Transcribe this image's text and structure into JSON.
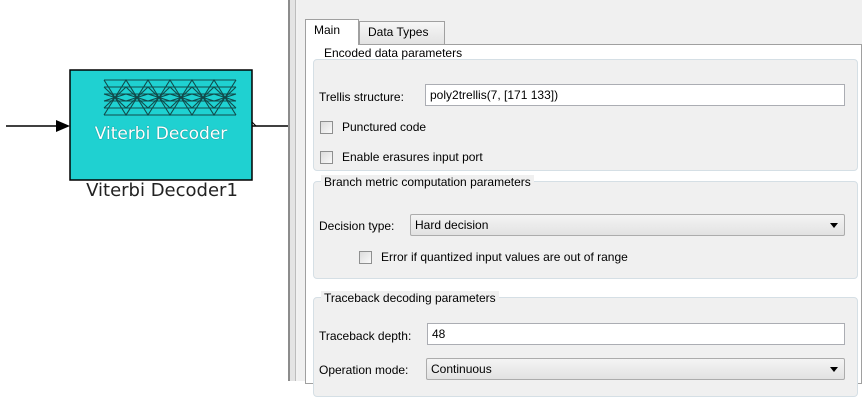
{
  "block": {
    "inner_label": "Viterbi Decoder",
    "name": "Viterbi Decoder1",
    "fill_color": "#1fd1d1"
  },
  "tabs": [
    {
      "label": "Main",
      "active": true
    },
    {
      "label": "Data Types",
      "active": false
    }
  ],
  "encoded": {
    "title": "Encoded data parameters",
    "trellis_label": "Trellis structure:",
    "trellis_value": "poly2trellis(7, [171 133])",
    "punctured_label": "Punctured code",
    "punctured_checked": false,
    "erasures_label": "Enable erasures input port",
    "erasures_checked": false
  },
  "branch": {
    "title": "Branch metric computation parameters",
    "decision_label": "Decision type:",
    "decision_value": "Hard decision",
    "error_label": "Error if quantized input values are out of range",
    "error_checked": false
  },
  "traceback": {
    "title": "Traceback decoding parameters",
    "depth_label": "Traceback depth:",
    "depth_value": "48",
    "mode_label": "Operation mode:",
    "mode_value": "Continuous"
  }
}
